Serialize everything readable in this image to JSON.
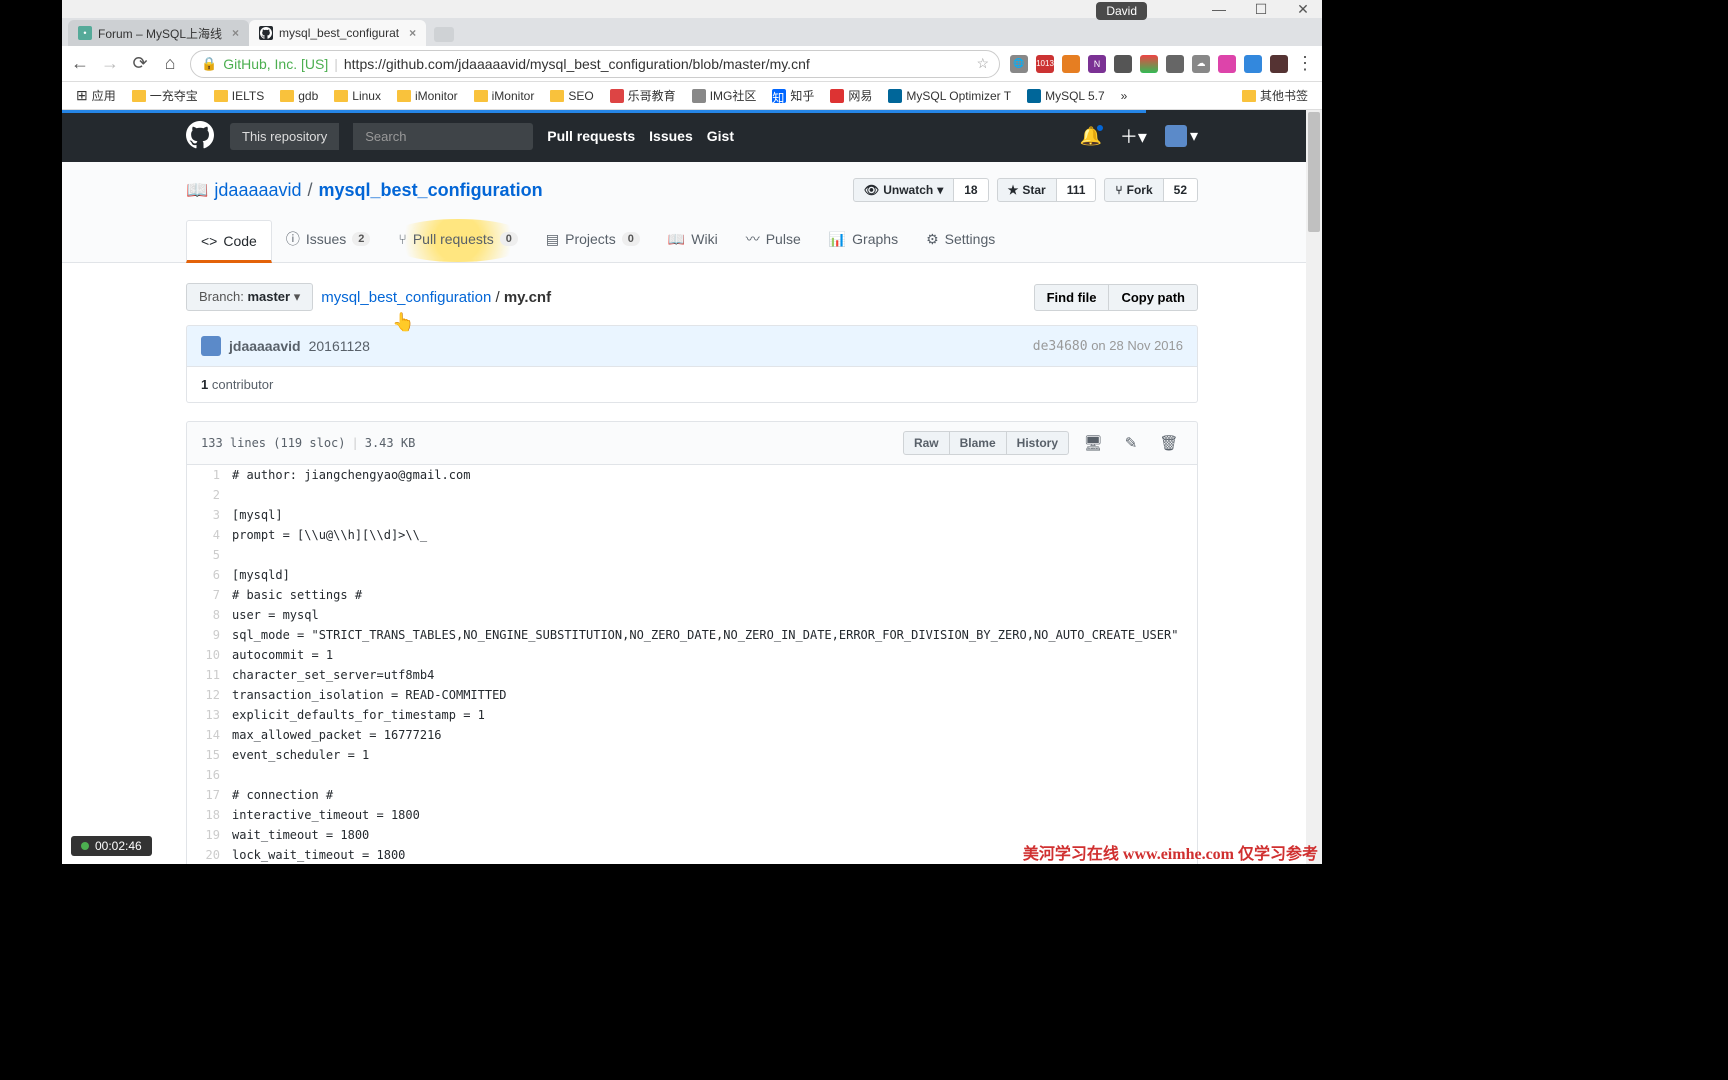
{
  "window": {
    "user_badge": "David",
    "tabs": [
      {
        "title": "Forum – MySQL上海线",
        "icon_bg": "#5a9",
        "icon_txt": "F",
        "active": false
      },
      {
        "title": "mysql_best_configurat",
        "icon_bg": "#24292e",
        "icon_txt": "",
        "active": true
      }
    ]
  },
  "addr": {
    "secure_label": "GitHub, Inc. [US]",
    "url": "https://github.com/jdaaaaavid/mysql_best_configuration/blob/master/my.cnf"
  },
  "bookmarks": {
    "apps": "应用",
    "items": [
      "一充夺宝",
      "IELTS",
      "gdb",
      "Linux",
      "iMonitor",
      "iMonitor",
      "SEO",
      "乐哥教育",
      "IMG社区",
      "知乎",
      "网易",
      "MySQL Optimizer T",
      "MySQL 5.7"
    ],
    "overflow": "»",
    "other": "其他书签"
  },
  "gh": {
    "scope": "This repository",
    "search_placeholder": "Search",
    "links": [
      "Pull requests",
      "Issues",
      "Gist"
    ]
  },
  "repo": {
    "owner": "jdaaaaavid",
    "name": "mysql_best_configuration",
    "watch": {
      "label": "Unwatch",
      "count": "18"
    },
    "star": {
      "label": "Star",
      "count": "111"
    },
    "fork": {
      "label": "Fork",
      "count": "52"
    },
    "nav": {
      "code": "Code",
      "issues": {
        "label": "Issues",
        "count": "2"
      },
      "pr": {
        "label": "Pull requests",
        "count": "0"
      },
      "projects": {
        "label": "Projects",
        "count": "0"
      },
      "wiki": "Wiki",
      "pulse": "Pulse",
      "graphs": "Graphs",
      "settings": "Settings"
    }
  },
  "file": {
    "branch_prefix": "Branch:",
    "branch": "master",
    "path_root": "mysql_best_configuration",
    "path_file": "my.cnf",
    "find": "Find file",
    "copy": "Copy path",
    "commit_author": "jdaaaaavid",
    "commit_msg": "20161128",
    "commit_hash": "de34680",
    "commit_date": "on 28 Nov 2016",
    "contributors_n": "1",
    "contributors_label": "contributor",
    "stats_lines": "133 lines (119 sloc)",
    "stats_size": "3.43 KB",
    "raw": "Raw",
    "blame": "Blame",
    "history": "History"
  },
  "code": {
    "lines": [
      "# author: jiangchengyao@gmail.com",
      "",
      "[mysql]",
      "prompt = [\\\\u@\\\\h][\\\\d]>\\\\_",
      "",
      "[mysqld]",
      "# basic settings #",
      "user = mysql",
      "sql_mode = \"STRICT_TRANS_TABLES,NO_ENGINE_SUBSTITUTION,NO_ZERO_DATE,NO_ZERO_IN_DATE,ERROR_FOR_DIVISION_BY_ZERO,NO_AUTO_CREATE_USER\"",
      "autocommit = 1",
      "character_set_server=utf8mb4",
      "transaction_isolation = READ-COMMITTED",
      "explicit_defaults_for_timestamp = 1",
      "max_allowed_packet = 16777216",
      "event_scheduler = 1",
      "",
      "# connection #",
      "interactive_timeout = 1800",
      "wait_timeout = 1800",
      "lock_wait_timeout = 1800"
    ]
  },
  "timer": "00:02:46",
  "watermark": "美河学习在线 www.eimhe.com 仅学习参考"
}
